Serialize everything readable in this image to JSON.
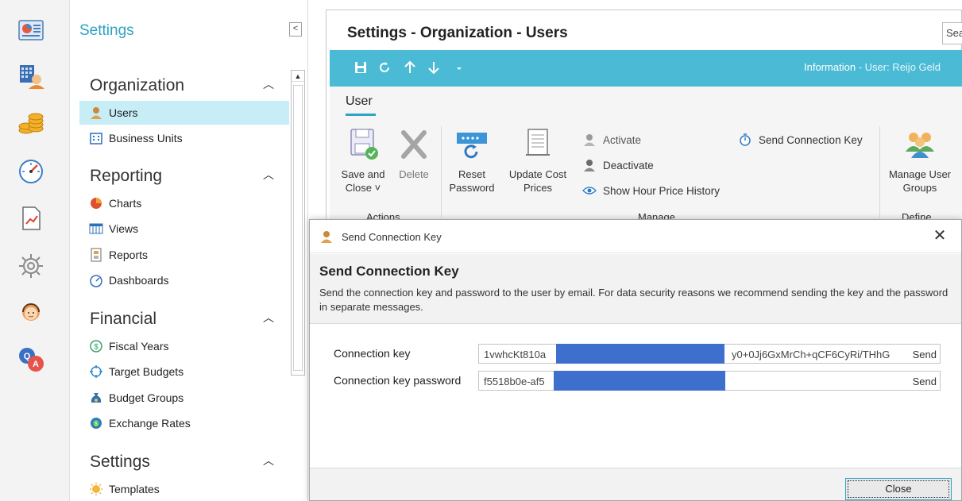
{
  "rail": {
    "icons": [
      "dashboard-icon",
      "timesheet-user-icon",
      "coins-icon",
      "gauge-icon",
      "report-chart-icon",
      "gear-icon",
      "support-agent-icon",
      "qa-icon"
    ]
  },
  "nav": {
    "title": "Settings",
    "collapse_label": "<",
    "groups": [
      {
        "label": "Organization",
        "items": [
          {
            "label": "Users",
            "icon": "user-icon",
            "active": true
          },
          {
            "label": "Business Units",
            "icon": "building-icon"
          }
        ]
      },
      {
        "label": "Reporting",
        "items": [
          {
            "label": "Charts",
            "icon": "pie-chart-icon"
          },
          {
            "label": "Views",
            "icon": "table-icon"
          },
          {
            "label": "Reports",
            "icon": "report-icon"
          },
          {
            "label": "Dashboards",
            "icon": "dashboard-gauge-icon"
          }
        ]
      },
      {
        "label": "Financial",
        "items": [
          {
            "label": "Fiscal Years",
            "icon": "dollar-icon"
          },
          {
            "label": "Target Budgets",
            "icon": "target-icon"
          },
          {
            "label": "Budget Groups",
            "icon": "money-bag-icon"
          },
          {
            "label": "Exchange Rates",
            "icon": "exchange-icon"
          }
        ]
      },
      {
        "label": "Settings",
        "items": [
          {
            "label": "Templates",
            "icon": "sun-icon"
          }
        ]
      }
    ]
  },
  "main": {
    "title": "Settings - Organization - Users",
    "search_text": "Sea",
    "toolbar": {
      "icons": [
        "save-icon",
        "refresh-icon",
        "arrow-up-icon",
        "arrow-down-icon",
        "dropdown-icon"
      ],
      "info_prefix": "Information",
      "info_user": " - User: Reijo Geld"
    },
    "ribbon": {
      "tab": "User",
      "save_close_1": "Save and",
      "save_close_2": "Close ˅",
      "delete": "Delete",
      "reset_1": "Reset",
      "reset_2": "Password",
      "update_1": "Update Cost",
      "update_2": "Prices",
      "activate": "Activate",
      "deactivate": "Deactivate",
      "show_history": "Show Hour Price History",
      "send_key": "Send Connection Key",
      "manage_1": "Manage User",
      "manage_2": "Groups",
      "group_actions": "Actions",
      "group_manage": "Manage",
      "group_define": "Define"
    }
  },
  "dialog": {
    "title": "Send Connection Key",
    "close_x": "✕",
    "heading": "Send Connection Key",
    "description": "Send the connection key and password to the user by email. For data security reasons we recommend sending the key and the password in separate messages.",
    "key_label": "Connection key",
    "key_value_start": "1vwhcKt810a",
    "key_value_end": "y0+0Jj6GxMrCh+qCF6CyRi/THhG",
    "key_send": "Send",
    "pwd_label": "Connection key password",
    "pwd_value_start": "f5518b0e-af5",
    "pwd_send": "Send",
    "close_button": "Close"
  },
  "colors": {
    "accent": "#2ea3c4",
    "toolbar": "#4bbbd5",
    "active_nav": "#c7edf7",
    "redaction": "#3f6fcc"
  }
}
